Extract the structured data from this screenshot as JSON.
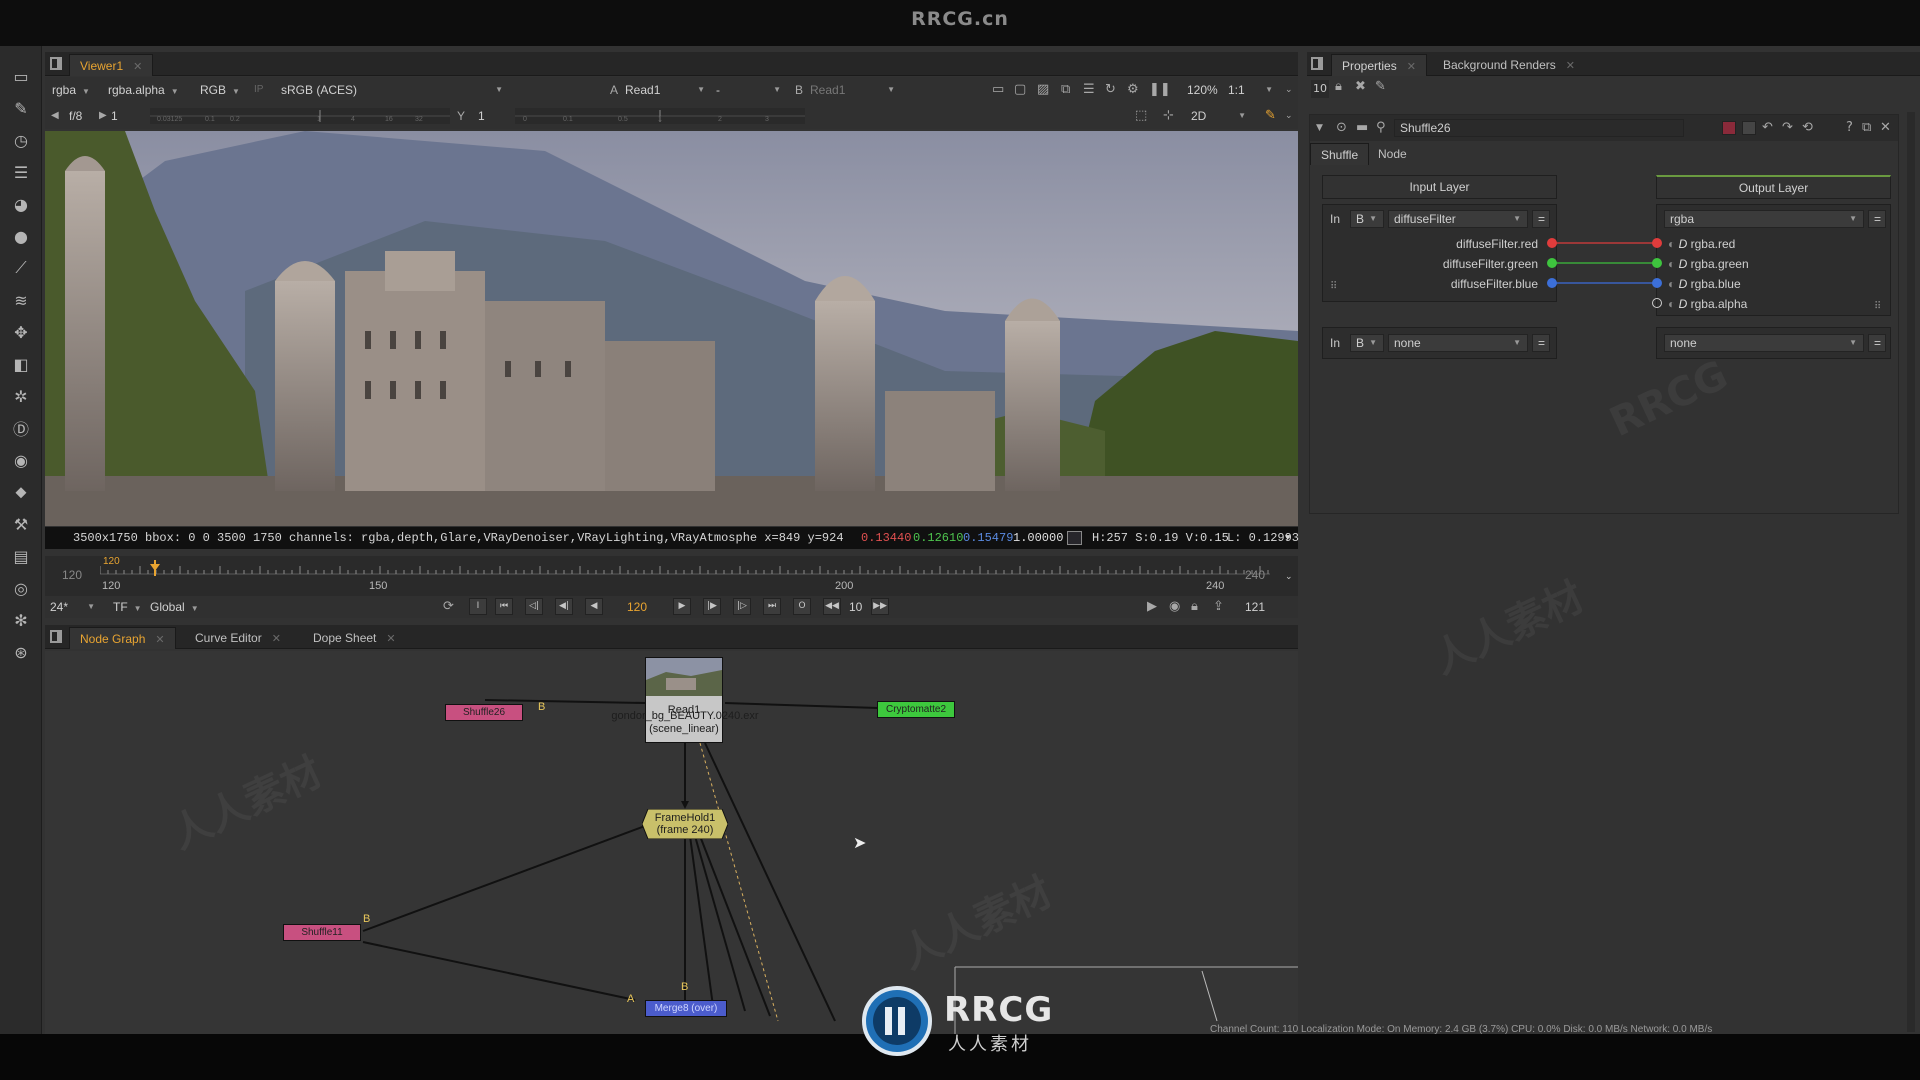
{
  "site": {
    "title": "RRCG.cn",
    "logo_text": "RRCG",
    "logo_sub": "人人素材"
  },
  "viewer": {
    "tab": "Viewer1",
    "channels": "rgba",
    "alpha": "rgba.alpha",
    "colorspace": "RGB",
    "ip": "IP",
    "lut": "sRGB (ACES)",
    "input_a_label": "A",
    "input_a": "Read1",
    "composite": "-",
    "input_b_label": "B",
    "input_b": "Read1",
    "zoom": "120%",
    "ratio": "1:1",
    "fstop": "f/8",
    "gain": "1",
    "gamma_label": "Y",
    "gamma": "1",
    "view_mode": "2D",
    "gain_ticks": [
      "0.03125",
      "0.1",
      "0.2",
      "1",
      "4",
      "16",
      "32"
    ],
    "gamma_ticks": [
      "0",
      "0.1",
      "0.5",
      "1",
      "2",
      "3"
    ]
  },
  "info": {
    "format": "3500x1750  bbox: 0 0 3500 1750 channels: rgba,depth,Glare,VRayDenoiser,VRayLighting,VRayAtmosphe  x=849 y=924",
    "r": "0.13440",
    "g": "0.12610",
    "b": "0.15479",
    "a": "1.00000",
    "hsv": "H:257 S:0.19 V:0.15",
    "lum": "L: 0.12993"
  },
  "timeline": {
    "start": "120",
    "end": "240",
    "current": "120",
    "ticks": [
      "120",
      "150",
      "200",
      "240"
    ],
    "fps": "24*",
    "tf": "TF",
    "scope": "Global",
    "frame_field": "120",
    "increment": "10",
    "end_field": "121"
  },
  "bottom_tabs": [
    "Node Graph",
    "Curve Editor",
    "Dope Sheet"
  ],
  "nodes": {
    "read": {
      "name": "Read1",
      "file": "gondor_bg_BEAUTY.0240.exr",
      "colorspace": "(scene_linear)"
    },
    "shuffle26": "Shuffle26",
    "cryptomatte": "Cryptomatte2",
    "framehold": "FrameHold1",
    "framehold_sub": "(frame 240)",
    "shuffle11": "Shuffle11",
    "merge": "Merge8 (over)",
    "pipe_b": "B",
    "pipe_a": "A"
  },
  "properties": {
    "tabs": [
      "Properties",
      "Background Renders"
    ],
    "max_panels": "10",
    "node_name": "Shuffle26",
    "subtabs": [
      "Shuffle",
      "Node"
    ],
    "input_layer_title": "Input Layer",
    "output_layer_title": "Output Layer",
    "in_label": "In",
    "in_source": "B",
    "input1_layer": "diffuseFilter",
    "input_channels": [
      "diffuseFilter.red",
      "diffuseFilter.green",
      "diffuseFilter.blue"
    ],
    "output1_layer": "rgba",
    "output_channels": [
      "rgba.red",
      "rgba.green",
      "rgba.blue",
      "rgba.alpha"
    ],
    "input2_layer": "none",
    "output2_layer": "none"
  },
  "status": "Channel Count: 110  Localization Mode: On  Memory: 2.4 GB (3.7%)  CPU: 0.0%  Disk: 0.0 MB/s  Network: 0.0 MB/s",
  "colors": {
    "accent": "#e8a431",
    "red": "#e03c3c",
    "green": "#3ec43e",
    "blue": "#3c6fd8"
  }
}
